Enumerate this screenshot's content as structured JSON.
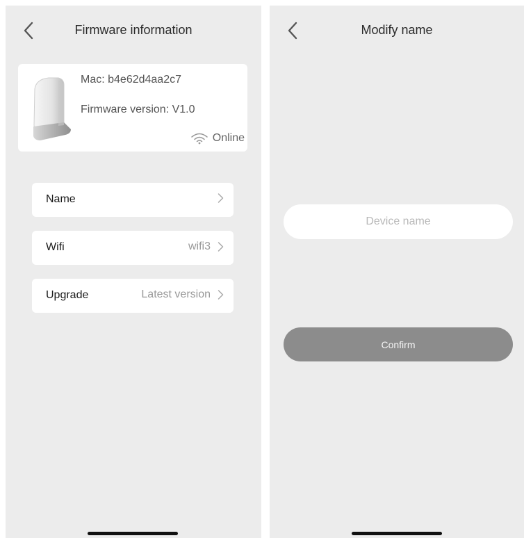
{
  "firmware_screen": {
    "title": "Firmware information",
    "device": {
      "mac": "Mac: b4e62d4aa2c7",
      "firmware_version": "Firmware version: V1.0",
      "status": "Online"
    },
    "rows": [
      {
        "label": "Name",
        "value": ""
      },
      {
        "label": "Wifi",
        "value": "wifi3"
      },
      {
        "label": "Upgrade",
        "value": "Latest version"
      }
    ]
  },
  "modify_screen": {
    "title": "Modify name",
    "name_input": {
      "placeholder": "Device name",
      "value": ""
    },
    "confirm_label": "Confirm"
  },
  "colors": {
    "background": "#ececec",
    "card": "#ffffff",
    "button": "#8c8c8c"
  }
}
